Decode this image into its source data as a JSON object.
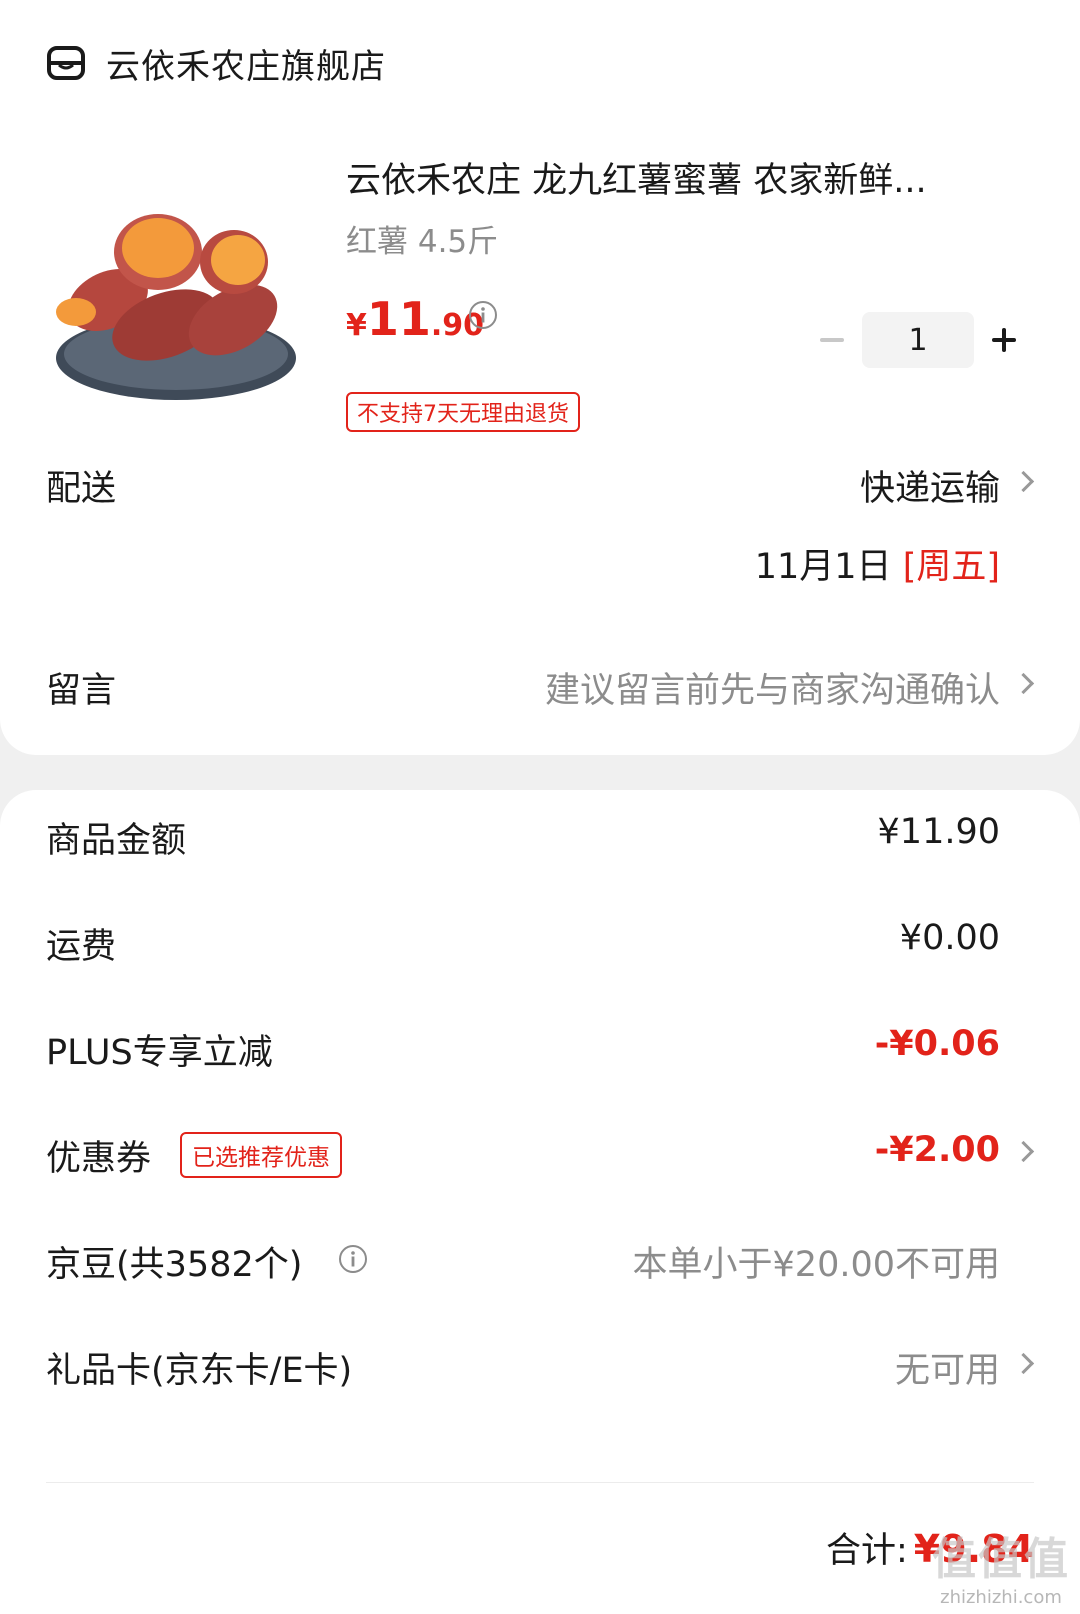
{
  "shop": {
    "name": "云依禾农庄旗舰店",
    "icon": "store-icon"
  },
  "product": {
    "title": "云依禾农庄 龙九红薯蜜薯 农家新鲜...",
    "spec": "红薯 4.5斤",
    "price_currency": "¥",
    "price_integer": "11",
    "price_decimal": ".90",
    "return_tag": "不支持7天无理由退货",
    "quantity": "1",
    "image": "sweet-potato-image"
  },
  "delivery": {
    "label": "配送",
    "method": "快递运输",
    "date": "11月1日",
    "weekday": "[周五]"
  },
  "message": {
    "label": "留言",
    "placeholder": "建议留言前先与商家沟通确认"
  },
  "summary": {
    "goods_label": "商品金额",
    "goods_value": "¥11.90",
    "shipping_label": "运费",
    "shipping_value": "¥0.00",
    "plus_label": "PLUS专享立减",
    "plus_value": "-¥0.06",
    "coupon_label": "优惠券",
    "coupon_tag": "已选推荐优惠",
    "coupon_value": "-¥2.00",
    "beans_label": "京豆(共3582个)",
    "beans_value": "本单小于¥20.00不可用",
    "giftcard_label": "礼品卡(京东卡/E卡)",
    "giftcard_value": "无可用"
  },
  "total": {
    "label": "合计:",
    "amount": "¥9.84"
  },
  "watermark": {
    "big": "值值值",
    "small": "zhizhizhi.com"
  },
  "colors": {
    "accent": "#e2231a",
    "muted": "#8c8c8c"
  }
}
